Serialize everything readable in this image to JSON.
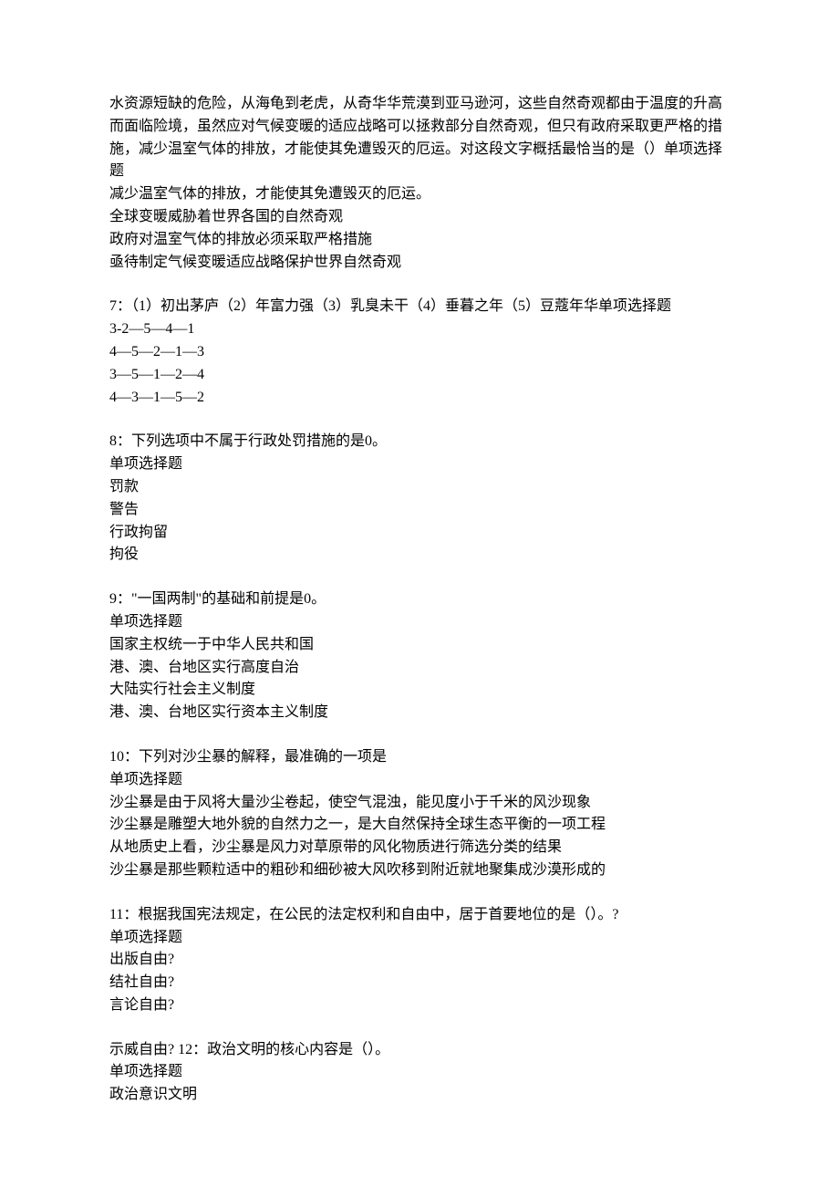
{
  "blocks": [
    {
      "name": "q6-continued",
      "lines": [
        "水资源短缺的危险，从海龟到老虎，从奇华华荒漠到亚马逊河，这些自然奇观都由于温度的升高而面临险境，虽然应对气候变暖的适应战略可以拯救部分自然奇观，但只有政府采取更严格的措施，减少温室气体的排放，才能使其免遭毁灭的厄运。对这段文字概括最恰当的是（）单项选择题",
        "减少温室气体的排放，才能使其免遭毁灭的厄运。",
        "全球变暖威胁着世界各国的自然奇观",
        "政府对温室气体的排放必须采取严格措施",
        "亟待制定气候变暖适应战略保护世界自然奇观"
      ]
    },
    {
      "name": "q7",
      "lines": [
        "7：（1）初出茅庐（2）年富力强（3）乳臭未干（4）垂暮之年（5）豆蔻年华单项选择题",
        "3-2—5—4—1",
        "4—5—2—1—3",
        "3—5—1—2—4",
        "4—3—1—5—2"
      ]
    },
    {
      "name": "q8",
      "lines": [
        "8：下列选项中不属于行政处罚措施的是0。",
        "单项选择题",
        "罚款",
        "警告",
        "行政拘留",
        "拘役"
      ]
    },
    {
      "name": "q9",
      "lines": [
        "9：\"一国两制\"的基础和前提是0。",
        "单项选择题",
        "国家主权统一于中华人民共和国",
        "港、澳、台地区实行高度自治",
        "大陆实行社会主义制度",
        "港、澳、台地区实行资本主义制度"
      ]
    },
    {
      "name": "q10",
      "lines": [
        "10：下列对沙尘暴的解释，最准确的一项是",
        "单项选择题",
        "沙尘暴是由于风将大量沙尘卷起，使空气混浊，能见度小于千米的风沙现象",
        "沙尘暴是雕塑大地外貌的自然力之一，是大自然保持全球生态平衡的一项工程",
        "从地质史上看，沙尘暴是风力对草原带的风化物质进行筛选分类的结果",
        "沙尘暴是那些颗粒适中的粗砂和细砂被大风吹移到附近就地聚集成沙漠形成的"
      ]
    },
    {
      "name": "q11",
      "lines": [
        "11：根据我国宪法规定，在公民的法定权利和自由中，居于首要地位的是（）。?",
        "单项选择题",
        "出版自由?",
        "结社自由?",
        "言论自由?"
      ]
    },
    {
      "name": "q12",
      "lines": [
        "示威自由? 12：政治文明的核心内容是（）。",
        "单项选择题",
        "政治意识文明"
      ]
    }
  ]
}
